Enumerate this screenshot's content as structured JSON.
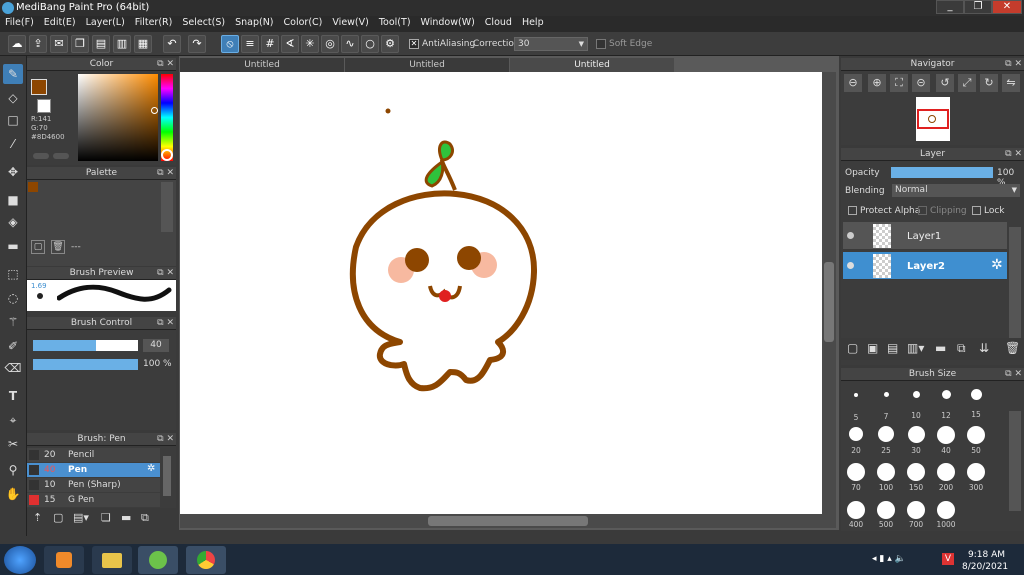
{
  "window": {
    "title": "MediBang Paint Pro (64bit)",
    "controls": [
      "_",
      "❐",
      "✕"
    ]
  },
  "menu": [
    "File(F)",
    "Edit(E)",
    "Layer(L)",
    "Filter(R)",
    "Select(S)",
    "Snap(N)",
    "Color(C)",
    "View(V)",
    "Tool(T)",
    "Window(W)",
    "Cloud",
    "Help"
  ],
  "toolbar": {
    "antialiasing_label": "AntiAliasing",
    "correction_label": "Correction",
    "correction_value": "30",
    "soft_edge_label": "Soft Edge"
  },
  "tabs": [
    "Untitled",
    "Untitled",
    "Untitled"
  ],
  "color_panel": {
    "title": "Color",
    "r": "R:141",
    "g": "G:70",
    "hex": "#8D4600",
    "primary_color": "#8d4600"
  },
  "palette": {
    "title": "Palette",
    "dashes": "---"
  },
  "brush_preview": {
    "title": "Brush Preview",
    "size": "1.69"
  },
  "brush_control": {
    "title": "Brush Control",
    "size": "40",
    "opacity": "100 %",
    "size_fraction": 0.6,
    "opacity_fraction": 1.0
  },
  "brush_list": {
    "title": "Brush: Pen",
    "items": [
      {
        "size": "20",
        "name": "Pencil",
        "color": "#333333"
      },
      {
        "size": "40",
        "name": "Pen",
        "color": "#333333",
        "selected": true
      },
      {
        "size": "10",
        "name": "Pen (Sharp)",
        "color": "#333333"
      },
      {
        "size": "15",
        "name": "G Pen",
        "color": "#e03030"
      }
    ]
  },
  "navigator": {
    "title": "Navigator"
  },
  "layer": {
    "title": "Layer",
    "opacity_label": "Opacity",
    "opacity_value": "100 %",
    "blending_label": "Blending",
    "blending_value": "Normal",
    "protect_alpha": "Protect Alpha",
    "clipping": "Clipping",
    "lock": "Lock",
    "layers": [
      {
        "name": "Layer1",
        "selected": false
      },
      {
        "name": "Layer2",
        "selected": true
      }
    ]
  },
  "brush_size": {
    "title": "Brush Size",
    "sizes": [
      "5",
      "7",
      "10",
      "12",
      "15",
      "20",
      "25",
      "30",
      "40",
      "50",
      "70",
      "100",
      "150",
      "200",
      "300",
      "400",
      "500",
      "700",
      "1000"
    ]
  },
  "taskbar": {
    "time": "9:18 AM",
    "date": "8/20/2021"
  },
  "colors": {
    "accent": "#3f8fd0",
    "drawing": "#8d4600",
    "leaf": "#2fc23c",
    "cheek": "#f7b9a0",
    "mouth": "#e02020"
  }
}
